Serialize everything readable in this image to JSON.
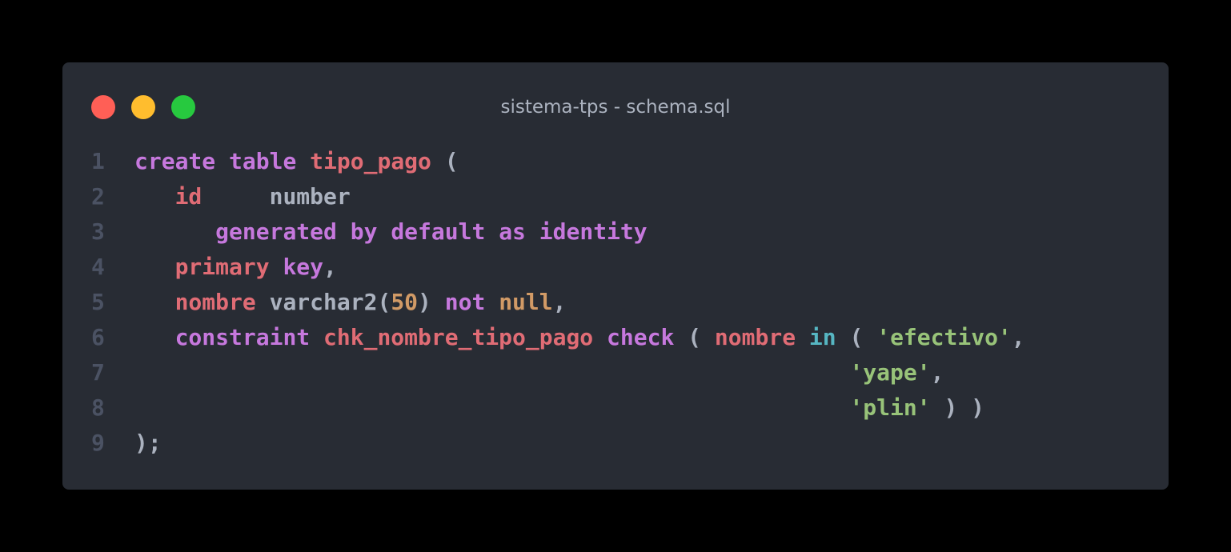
{
  "window": {
    "title": "sistema-tps - schema.sql",
    "controls": [
      {
        "name": "close",
        "color": "#ff5f56"
      },
      {
        "name": "minimize",
        "color": "#ffbd2e"
      },
      {
        "name": "maximize",
        "color": "#27c93f"
      }
    ]
  },
  "theme": {
    "background": "#282c34",
    "keyword": "#c678dd",
    "identifier": "#e06c75",
    "plain": "#abb2bf",
    "number": "#d19a66",
    "operator": "#56b6c2",
    "string": "#98c379",
    "line_number": "#4b5263"
  },
  "code": {
    "language": "sql",
    "lines": [
      {
        "n": "1",
        "tokens": [
          {
            "t": "create",
            "k": "kw"
          },
          {
            "t": " ",
            "k": "punct"
          },
          {
            "t": "table",
            "k": "kw"
          },
          {
            "t": " ",
            "k": "punct"
          },
          {
            "t": "tipo_pago",
            "k": "ident"
          },
          {
            "t": " (",
            "k": "punct"
          }
        ]
      },
      {
        "n": "2",
        "tokens": [
          {
            "t": "   ",
            "k": "punct"
          },
          {
            "t": "id",
            "k": "ident"
          },
          {
            "t": "     ",
            "k": "punct"
          },
          {
            "t": "number",
            "k": "type"
          }
        ]
      },
      {
        "n": "3",
        "tokens": [
          {
            "t": "      ",
            "k": "punct"
          },
          {
            "t": "generated",
            "k": "kw"
          },
          {
            "t": " ",
            "k": "punct"
          },
          {
            "t": "by",
            "k": "kw"
          },
          {
            "t": " ",
            "k": "punct"
          },
          {
            "t": "default",
            "k": "kw"
          },
          {
            "t": " ",
            "k": "punct"
          },
          {
            "t": "as",
            "k": "kw"
          },
          {
            "t": " ",
            "k": "punct"
          },
          {
            "t": "identity",
            "k": "kw"
          }
        ]
      },
      {
        "n": "4",
        "tokens": [
          {
            "t": "   ",
            "k": "punct"
          },
          {
            "t": "primary",
            "k": "ident"
          },
          {
            "t": " ",
            "k": "punct"
          },
          {
            "t": "key",
            "k": "kw"
          },
          {
            "t": ",",
            "k": "punct"
          }
        ]
      },
      {
        "n": "5",
        "tokens": [
          {
            "t": "   ",
            "k": "punct"
          },
          {
            "t": "nombre",
            "k": "ident"
          },
          {
            "t": " ",
            "k": "punct"
          },
          {
            "t": "varchar2(",
            "k": "type"
          },
          {
            "t": "50",
            "k": "num"
          },
          {
            "t": ")",
            "k": "type"
          },
          {
            "t": " ",
            "k": "punct"
          },
          {
            "t": "not",
            "k": "kw"
          },
          {
            "t": " ",
            "k": "punct"
          },
          {
            "t": "null",
            "k": "null"
          },
          {
            "t": ",",
            "k": "punct"
          }
        ]
      },
      {
        "n": "6",
        "tokens": [
          {
            "t": "   ",
            "k": "punct"
          },
          {
            "t": "constraint",
            "k": "kw"
          },
          {
            "t": " ",
            "k": "punct"
          },
          {
            "t": "chk_nombre_tipo_pago",
            "k": "ident"
          },
          {
            "t": " ",
            "k": "punct"
          },
          {
            "t": "check",
            "k": "kw"
          },
          {
            "t": " ( ",
            "k": "punct"
          },
          {
            "t": "nombre",
            "k": "ident"
          },
          {
            "t": " ",
            "k": "punct"
          },
          {
            "t": "in",
            "k": "op"
          },
          {
            "t": " ( ",
            "k": "punct"
          },
          {
            "t": "'efectivo'",
            "k": "str"
          },
          {
            "t": ",",
            "k": "punct"
          }
        ]
      },
      {
        "n": "7",
        "tokens": [
          {
            "t": "                                                     ",
            "k": "punct"
          },
          {
            "t": "'yape'",
            "k": "str"
          },
          {
            "t": ",",
            "k": "punct"
          }
        ]
      },
      {
        "n": "8",
        "tokens": [
          {
            "t": "                                                     ",
            "k": "punct"
          },
          {
            "t": "'plin'",
            "k": "str"
          },
          {
            "t": " ) )",
            "k": "punct"
          }
        ]
      },
      {
        "n": "9",
        "tokens": [
          {
            "t": ");",
            "k": "punct"
          }
        ]
      }
    ]
  }
}
